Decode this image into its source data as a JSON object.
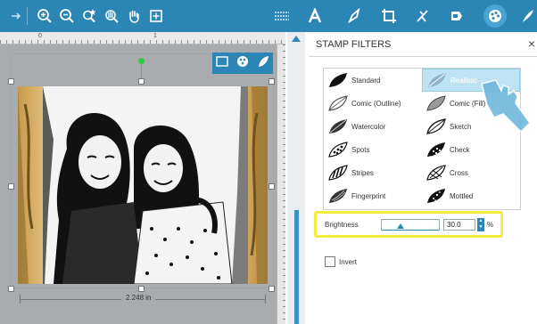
{
  "toolbar": {
    "left_icons": [
      "arrow-right-icon",
      "zoom-in-icon",
      "zoom-out-icon",
      "zoom-selection-icon",
      "zoom-drag-icon",
      "pan-icon",
      "fit-page-icon"
    ],
    "right_icons": [
      "lines-icon",
      "text-icon",
      "edit-points-icon",
      "crop-icon",
      "knife-icon",
      "offset-icon",
      "stamp-icon",
      "pen-icon"
    ]
  },
  "ruler": {
    "labels": [
      "0",
      "1"
    ]
  },
  "canvas": {
    "width_label": "2.248 in"
  },
  "panel": {
    "title": "STAMP FILTERS",
    "close": "×",
    "filters": [
      {
        "label": "Standard",
        "icon": "leaf-standard-icon"
      },
      {
        "label": "Realistic",
        "icon": "leaf-realistic-icon",
        "selected": true
      },
      {
        "label": "Comic (Outline)",
        "icon": "leaf-comic-outline-icon"
      },
      {
        "label": "Comic (Fill)",
        "icon": "leaf-comic-fill-icon"
      },
      {
        "label": "Watercolor",
        "icon": "leaf-watercolor-icon"
      },
      {
        "label": "Sketch",
        "icon": "leaf-sketch-icon"
      },
      {
        "label": "Spots",
        "icon": "leaf-spots-icon"
      },
      {
        "label": "Check",
        "icon": "leaf-check-icon"
      },
      {
        "label": "Stripes",
        "icon": "leaf-stripes-icon"
      },
      {
        "label": "Cross",
        "icon": "leaf-cross-icon"
      },
      {
        "label": "Fingerprint",
        "icon": "leaf-fingerprint-icon"
      },
      {
        "label": "Mottled",
        "icon": "leaf-mottled-icon"
      }
    ],
    "brightness": {
      "label": "Brightness",
      "value": "30.0",
      "unit": "%"
    },
    "invert": {
      "label": "Invert",
      "checked": false
    }
  },
  "colors": {
    "accent": "#2b86b6",
    "highlight": "#f4ec3c",
    "selected": "#bfe3f5"
  }
}
